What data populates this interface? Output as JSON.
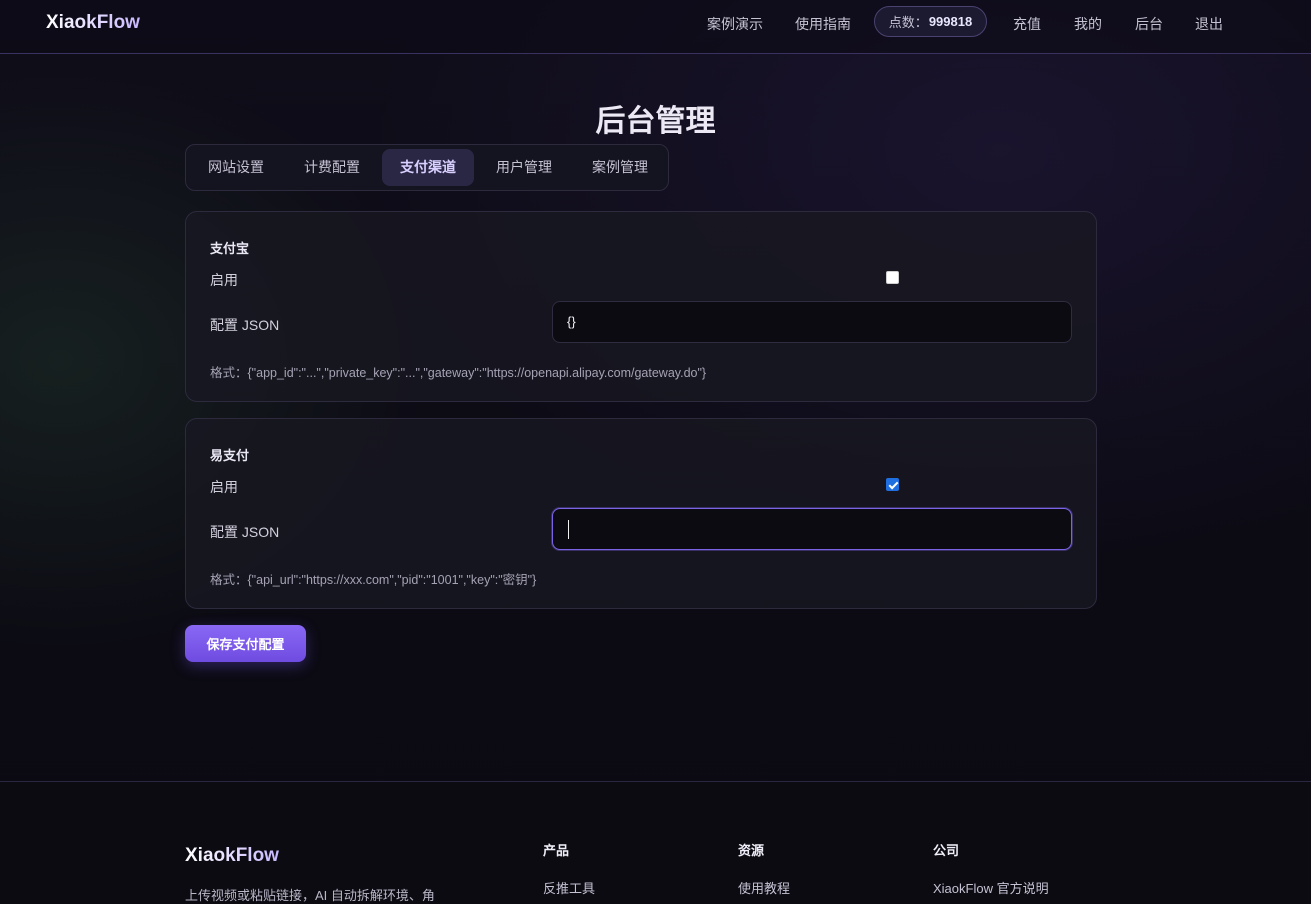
{
  "header": {
    "brand": "XiaokFlow",
    "nav": {
      "demo": "案例演示",
      "guide": "使用指南",
      "points_label": "点数：",
      "points_value": "999818",
      "recharge": "充值",
      "mine": "我的",
      "admin": "后台",
      "logout": "退出"
    }
  },
  "page": {
    "title": "后台管理"
  },
  "tabs": [
    {
      "label": "网站设置",
      "active": false
    },
    {
      "label": "计费配置",
      "active": false
    },
    {
      "label": "支付渠道",
      "active": true
    },
    {
      "label": "用户管理",
      "active": false
    },
    {
      "label": "案例管理",
      "active": false
    }
  ],
  "channels": {
    "alipay": {
      "title": "支付宝",
      "enable_label": "启用",
      "enabled": false,
      "config_label": "配置 JSON",
      "config_value": "{}",
      "hint": "格式：{\"app_id\":\"...\",\"private_key\":\"...\",\"gateway\":\"https://openapi.alipay.com/gateway.do\"}"
    },
    "epay": {
      "title": "易支付",
      "enable_label": "启用",
      "enabled": true,
      "config_label": "配置 JSON",
      "config_value": "",
      "hint": "格式：{\"api_url\":\"https://xxx.com\",\"pid\":\"1001\",\"key\":\"密钥\"}"
    }
  },
  "actions": {
    "save_label": "保存支付配置"
  },
  "footer": {
    "brand": "XiaokFlow",
    "description": "上传视频或粘贴链接，AI 自动拆解环境、角",
    "columns": [
      {
        "title": "产品",
        "link": "反推工具"
      },
      {
        "title": "资源",
        "link": "使用教程"
      },
      {
        "title": "公司",
        "link": "XiaokFlow 官方说明"
      }
    ]
  },
  "colors": {
    "accent": "#7c63e6",
    "checkbox_on": "#1f6fe0",
    "background": "#0d0c15"
  }
}
